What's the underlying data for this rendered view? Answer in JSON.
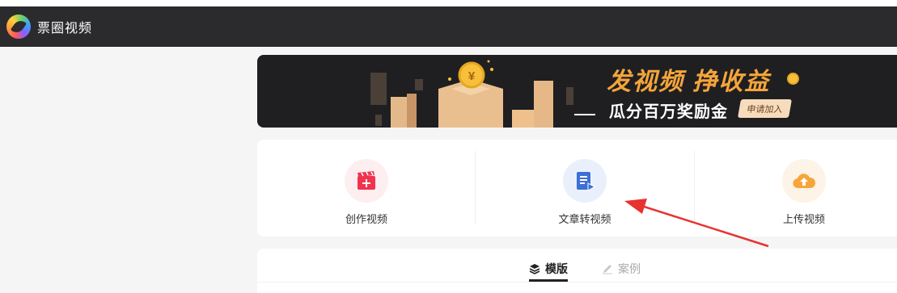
{
  "app": {
    "title": "票圈视频"
  },
  "banner": {
    "slogan": "发视频 挣收益",
    "subslogan": "瓜分百万奖励金",
    "apply_button": "申请加入",
    "coin_symbol": "¥"
  },
  "actions": [
    {
      "label": "创作视频",
      "icon": "clapperboard-plus-icon",
      "color": "#f0344f"
    },
    {
      "label": "文章转视频",
      "icon": "document-play-icon",
      "color": "#3d6fd6"
    },
    {
      "label": "上传视频",
      "icon": "cloud-upload-icon",
      "color": "#f5a53a"
    }
  ],
  "tabs": [
    {
      "label": "模版",
      "icon": "layers-icon",
      "active": true
    },
    {
      "label": "案例",
      "icon": "pencil-icon",
      "active": false
    }
  ],
  "annotation": {
    "type": "red-arrow",
    "color": "#e8322f"
  }
}
